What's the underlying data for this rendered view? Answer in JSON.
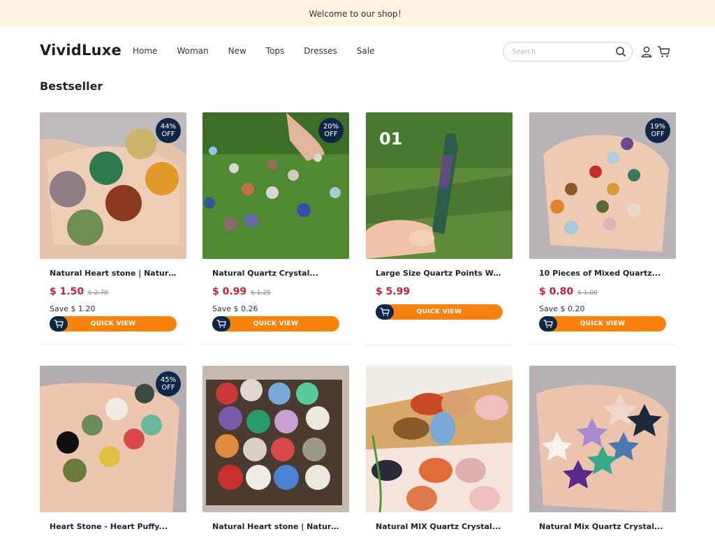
{
  "announcement": "Welcome to our shop！",
  "header": {
    "logo": "VividLuxe",
    "nav": [
      "Home",
      "Woman",
      "New",
      "Tops",
      "Dresses",
      "Sale"
    ],
    "search_placeholder": "Search"
  },
  "section_title": "Bestseller",
  "quick_view_label": "QUICK VIEW",
  "products": [
    {
      "name": "Natural Heart stone | Natural Pu...",
      "price": "$ 1.50",
      "old_price": "$ 2.70",
      "save": "Save $ 1.20",
      "badge_pct": "44%",
      "badge_off": "OFF"
    },
    {
      "name": "Natural Quartz Crystal...",
      "price": "$ 0.99",
      "old_price": "$ 1.25",
      "save": "Save $ 0.26",
      "badge_pct": "20%",
      "badge_off": "OFF"
    },
    {
      "name": "Large Size Quartz Points Wand-...",
      "price": "$ 5.99",
      "old_price": "",
      "save": "",
      "badge_pct": "",
      "badge_off": "",
      "image_text": "01"
    },
    {
      "name": "10 Pieces of Mixed Quartz...",
      "price": "$ 0.80",
      "old_price": "$ 1.00",
      "save": "Save $ 0.20",
      "badge_pct": "19%",
      "badge_off": "OFF"
    },
    {
      "name": "Heart Stone - Heart Puffy...",
      "badge_pct": "45%",
      "badge_off": "OFF"
    },
    {
      "name": "Natural Heart stone | Natural Pu...",
      "badge_pct": "",
      "badge_off": ""
    },
    {
      "name": "Natural MIX Quartz Crystal...",
      "badge_pct": "",
      "badge_off": ""
    },
    {
      "name": "Natural Mix Quartz Crystal...",
      "badge_pct": "",
      "badge_off": ""
    }
  ],
  "colors": {
    "accent": "#f7830d",
    "navy": "#0f2747",
    "price": "#c8203a",
    "banner": "#fdf3e1"
  }
}
